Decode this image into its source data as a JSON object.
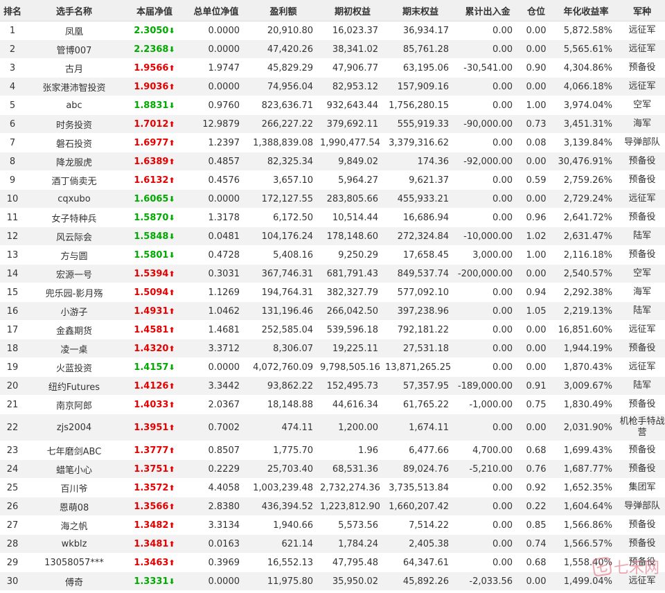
{
  "colors": {
    "up": "#e60000",
    "down": "#00aa00",
    "header_bg": "#f0f0f0",
    "stripe_bg": "#f2f2f2"
  },
  "header": {
    "rank": "排名",
    "name": "选手名称",
    "nav": "本届净值",
    "total_nav": "总单位净值",
    "profit": "盈利额",
    "start_equity": "期初权益",
    "end_equity": "期末权益",
    "net_flow": "累计出入金",
    "position": "仓位",
    "annual_return": "年化收益率",
    "branch": "军种"
  },
  "rows": [
    {
      "rank": "1",
      "name": "凤凰",
      "nav": "2.3050",
      "dir": "down",
      "total_nav": "0.0000",
      "profit": "20,910.80",
      "start_equity": "16,023.37",
      "end_equity": "36,934.17",
      "net_flow": "0.00",
      "position": "0.00",
      "annual_return": "5,872.58%",
      "branch": "远征军"
    },
    {
      "rank": "2",
      "name": "管博007",
      "nav": "2.2368",
      "dir": "down",
      "total_nav": "0.0000",
      "profit": "47,420.26",
      "start_equity": "38,341.02",
      "end_equity": "85,761.28",
      "net_flow": "0.00",
      "position": "0.00",
      "annual_return": "5,565.61%",
      "branch": "远征军"
    },
    {
      "rank": "3",
      "name": "古月",
      "nav": "1.9566",
      "dir": "up",
      "total_nav": "1.9747",
      "profit": "45,829.29",
      "start_equity": "47,906.77",
      "end_equity": "63,195.06",
      "net_flow": "-30,541.00",
      "position": "0.90",
      "annual_return": "4,304.86%",
      "branch": "预备役"
    },
    {
      "rank": "4",
      "name": "张家港沛智投资",
      "nav": "1.9036",
      "dir": "up",
      "total_nav": "0.0000",
      "profit": "74,956.04",
      "start_equity": "82,953.12",
      "end_equity": "157,909.16",
      "net_flow": "0.00",
      "position": "0.00",
      "annual_return": "4,066.18%",
      "branch": "远征军"
    },
    {
      "rank": "5",
      "name": "abc",
      "nav": "1.8831",
      "dir": "down",
      "total_nav": "0.9760",
      "profit": "823,636.71",
      "start_equity": "932,643.44",
      "end_equity": "1,756,280.15",
      "net_flow": "0.00",
      "position": "1.00",
      "annual_return": "3,974.04%",
      "branch": "空军"
    },
    {
      "rank": "6",
      "name": "时务投资",
      "nav": "1.7012",
      "dir": "up",
      "total_nav": "12.9879",
      "profit": "266,227.22",
      "start_equity": "379,692.11",
      "end_equity": "555,919.33",
      "net_flow": "-90,000.00",
      "position": "0.73",
      "annual_return": "3,451.31%",
      "branch": "海军"
    },
    {
      "rank": "7",
      "name": "磐石投资",
      "nav": "1.6977",
      "dir": "up",
      "total_nav": "1.2397",
      "profit": "1,388,839.08",
      "start_equity": "1,990,477.54",
      "end_equity": "3,379,316.62",
      "net_flow": "0.00",
      "position": "0.08",
      "annual_return": "3,139.84%",
      "branch": "导弹部队"
    },
    {
      "rank": "8",
      "name": "降龙服虎",
      "nav": "1.6389",
      "dir": "up",
      "total_nav": "0.4857",
      "profit": "82,325.34",
      "start_equity": "9,849.02",
      "end_equity": "174.36",
      "net_flow": "-92,000.00",
      "position": "0.00",
      "annual_return": "30,476.91%",
      "branch": "预备役"
    },
    {
      "rank": "9",
      "name": "酒丁倘卖无",
      "nav": "1.6132",
      "dir": "up",
      "total_nav": "0.4576",
      "profit": "3,657.10",
      "start_equity": "5,964.27",
      "end_equity": "9,621.37",
      "net_flow": "0.00",
      "position": "0.59",
      "annual_return": "2,759.26%",
      "branch": "预备役"
    },
    {
      "rank": "10",
      "name": "cqxubo",
      "nav": "1.6065",
      "dir": "down",
      "total_nav": "0.0000",
      "profit": "172,127.55",
      "start_equity": "283,805.66",
      "end_equity": "455,933.21",
      "net_flow": "0.00",
      "position": "0.00",
      "annual_return": "2,729.24%",
      "branch": "远征军"
    },
    {
      "rank": "11",
      "name": "女子特种兵",
      "nav": "1.5870",
      "dir": "down",
      "total_nav": "1.3178",
      "profit": "6,172.50",
      "start_equity": "10,514.44",
      "end_equity": "16,686.94",
      "net_flow": "0.00",
      "position": "0.96",
      "annual_return": "2,641.72%",
      "branch": "预备役"
    },
    {
      "rank": "12",
      "name": "风云际会",
      "nav": "1.5848",
      "dir": "down",
      "total_nav": "0.0481",
      "profit": "104,176.24",
      "start_equity": "178,148.60",
      "end_equity": "272,324.84",
      "net_flow": "-10,000.00",
      "position": "1.02",
      "annual_return": "2,631.47%",
      "branch": "陆军"
    },
    {
      "rank": "13",
      "name": "方与圆",
      "nav": "1.5801",
      "dir": "down",
      "total_nav": "0.4728",
      "profit": "5,408.16",
      "start_equity": "9,250.29",
      "end_equity": "17,658.45",
      "net_flow": "3,000.00",
      "position": "1.00",
      "annual_return": "2,116.18%",
      "branch": "预备役"
    },
    {
      "rank": "14",
      "name": "宏源一号",
      "nav": "1.5394",
      "dir": "up",
      "total_nav": "0.3031",
      "profit": "367,746.31",
      "start_equity": "681,791.43",
      "end_equity": "849,537.74",
      "net_flow": "-200,000.00",
      "position": "0.00",
      "annual_return": "2,540.57%",
      "branch": "空军"
    },
    {
      "rank": "15",
      "name": "兜乐园-影月殇",
      "nav": "1.5094",
      "dir": "up",
      "total_nav": "1.1269",
      "profit": "194,764.31",
      "start_equity": "382,327.79",
      "end_equity": "577,092.10",
      "net_flow": "0.00",
      "position": "0.94",
      "annual_return": "2,292.38%",
      "branch": "海军"
    },
    {
      "rank": "16",
      "name": "小游子",
      "nav": "1.4931",
      "dir": "up",
      "total_nav": "1.0462",
      "profit": "131,196.46",
      "start_equity": "266,042.50",
      "end_equity": "397,238.96",
      "net_flow": "0.00",
      "position": "1.05",
      "annual_return": "2,219.13%",
      "branch": "陆军"
    },
    {
      "rank": "17",
      "name": "金鑫期货",
      "nav": "1.4581",
      "dir": "up",
      "total_nav": "1.4681",
      "profit": "252,585.04",
      "start_equity": "539,596.18",
      "end_equity": "792,181.22",
      "net_flow": "0.00",
      "position": "0.00",
      "annual_return": "16,851.60%",
      "branch": "远征军"
    },
    {
      "rank": "18",
      "name": "凌一桌",
      "nav": "1.4320",
      "dir": "up",
      "total_nav": "3.3712",
      "profit": "8,306.07",
      "start_equity": "19,225.11",
      "end_equity": "27,531.18",
      "net_flow": "0.00",
      "position": "0.00",
      "annual_return": "1,944.19%",
      "branch": "预备役"
    },
    {
      "rank": "19",
      "name": "火蓝投资",
      "nav": "1.4157",
      "dir": "down",
      "total_nav": "0.0000",
      "profit": "4,072,760.09",
      "start_equity": "9,798,505.16",
      "end_equity": "13,871,265.25",
      "net_flow": "0.00",
      "position": "0.00",
      "annual_return": "1,870.43%",
      "branch": "远征军"
    },
    {
      "rank": "20",
      "name": "纽约Futures",
      "nav": "1.4126",
      "dir": "up",
      "total_nav": "3.3442",
      "profit": "93,862.22",
      "start_equity": "152,495.73",
      "end_equity": "57,357.95",
      "net_flow": "-189,000.00",
      "position": "0.91",
      "annual_return": "3,009.67%",
      "branch": "陆军"
    },
    {
      "rank": "21",
      "name": "南京阿郎",
      "nav": "1.4033",
      "dir": "up",
      "total_nav": "2.0367",
      "profit": "18,148.88",
      "start_equity": "44,616.34",
      "end_equity": "61,765.22",
      "net_flow": "-1,000.00",
      "position": "0.75",
      "annual_return": "1,830.49%",
      "branch": "预备役"
    },
    {
      "rank": "22",
      "name": "zjs2004",
      "nav": "1.3951",
      "dir": "up",
      "total_nav": "0.7002",
      "profit": "474.11",
      "start_equity": "1,200.00",
      "end_equity": "1,674.11",
      "net_flow": "0.00",
      "position": "0.00",
      "annual_return": "2,031.90%",
      "branch": "机枪手特战营",
      "tall": true
    },
    {
      "rank": "23",
      "name": "七年磨剑ABC",
      "nav": "1.3777",
      "dir": "up",
      "total_nav": "0.8507",
      "profit": "1,775.70",
      "start_equity": "1.96",
      "end_equity": "6,477.66",
      "net_flow": "4,700.00",
      "position": "0.68",
      "annual_return": "1,699.43%",
      "branch": "预备役"
    },
    {
      "rank": "24",
      "name": "蜡笔小心",
      "nav": "1.3751",
      "dir": "up",
      "total_nav": "0.2229",
      "profit": "25,703.40",
      "start_equity": "68,531.36",
      "end_equity": "89,024.76",
      "net_flow": "-5,210.00",
      "position": "0.76",
      "annual_return": "1,687.77%",
      "branch": "预备役"
    },
    {
      "rank": "25",
      "name": "百川爷",
      "nav": "1.3572",
      "dir": "up",
      "total_nav": "4.4058",
      "profit": "1,003,239.48",
      "start_equity": "2,732,274.36",
      "end_equity": "3,735,513.84",
      "net_flow": "0.00",
      "position": "0.92",
      "annual_return": "1,652.35%",
      "branch": "集团军"
    },
    {
      "rank": "26",
      "name": "恩萌08",
      "nav": "1.3566",
      "dir": "up",
      "total_nav": "2.8380",
      "profit": "436,394.52",
      "start_equity": "1,223,812.90",
      "end_equity": "1,660,207.42",
      "net_flow": "0.00",
      "position": "0.22",
      "annual_return": "1,604.64%",
      "branch": "导弹部队"
    },
    {
      "rank": "27",
      "name": "海之帆",
      "nav": "1.3482",
      "dir": "up",
      "total_nav": "3.3134",
      "profit": "1,940.66",
      "start_equity": "5,573.56",
      "end_equity": "7,514.22",
      "net_flow": "0.00",
      "position": "0.85",
      "annual_return": "1,566.86%",
      "branch": "预备役"
    },
    {
      "rank": "28",
      "name": "wkblz",
      "nav": "1.3481",
      "dir": "up",
      "total_nav": "0.0163",
      "profit": "621.14",
      "start_equity": "1,784.24",
      "end_equity": "2,405.38",
      "net_flow": "0.00",
      "position": "0.74",
      "annual_return": "1,566.57%",
      "branch": "预备役"
    },
    {
      "rank": "29",
      "name": "13058057***",
      "nav": "1.3463",
      "dir": "up",
      "total_nav": "0.3969",
      "profit": "16,552.13",
      "start_equity": "47,795.48",
      "end_equity": "64,347.61",
      "net_flow": "0.00",
      "position": "0.68",
      "annual_return": "1,558.40%",
      "branch": "预备役"
    },
    {
      "rank": "30",
      "name": "傅奇",
      "nav": "1.3331",
      "dir": "down",
      "total_nav": "0.0000",
      "profit": "11,975.80",
      "start_equity": "35,950.02",
      "end_equity": "45,892.26",
      "net_flow": "-2,033.56",
      "position": "0.00",
      "annual_return": "1,499.04%",
      "branch": "远征军"
    }
  ],
  "watermark": {
    "text": "七禾网",
    "icon": "qihe-logo-icon"
  }
}
